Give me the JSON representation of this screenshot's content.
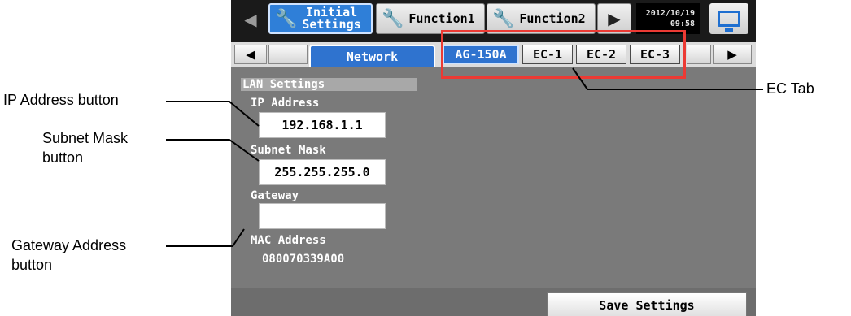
{
  "topbar": {
    "tab_initial_line1": "Initial",
    "tab_initial_line2": "Settings",
    "tab_function1": "Function1",
    "tab_function2": "Function2",
    "date": "2012/10/19",
    "time": "09:58"
  },
  "tabbar": {
    "network_label": "Network",
    "tabs": [
      "AG-150A",
      "EC-1",
      "EC-2",
      "EC-3"
    ]
  },
  "lan": {
    "section_title": "LAN Settings",
    "ip_label": "IP Address",
    "ip_value": "192.168.1.1",
    "subnet_label": "Subnet Mask",
    "subnet_value": "255.255.255.0",
    "gateway_label": "Gateway",
    "gateway_value": "",
    "mac_label": "MAC Address",
    "mac_value": "080070339A00"
  },
  "save_label": "Save Settings",
  "annotations": {
    "ip_button": "IP Address button",
    "subnet_line1": "Subnet Mask",
    "subnet_line2": "button",
    "gateway_line1": "Gateway Address",
    "gateway_line2": "button",
    "ec_tab": "EC Tab"
  },
  "colors": {
    "highlight_box": "#ec3a34",
    "active_tab": "#2f73cf"
  }
}
